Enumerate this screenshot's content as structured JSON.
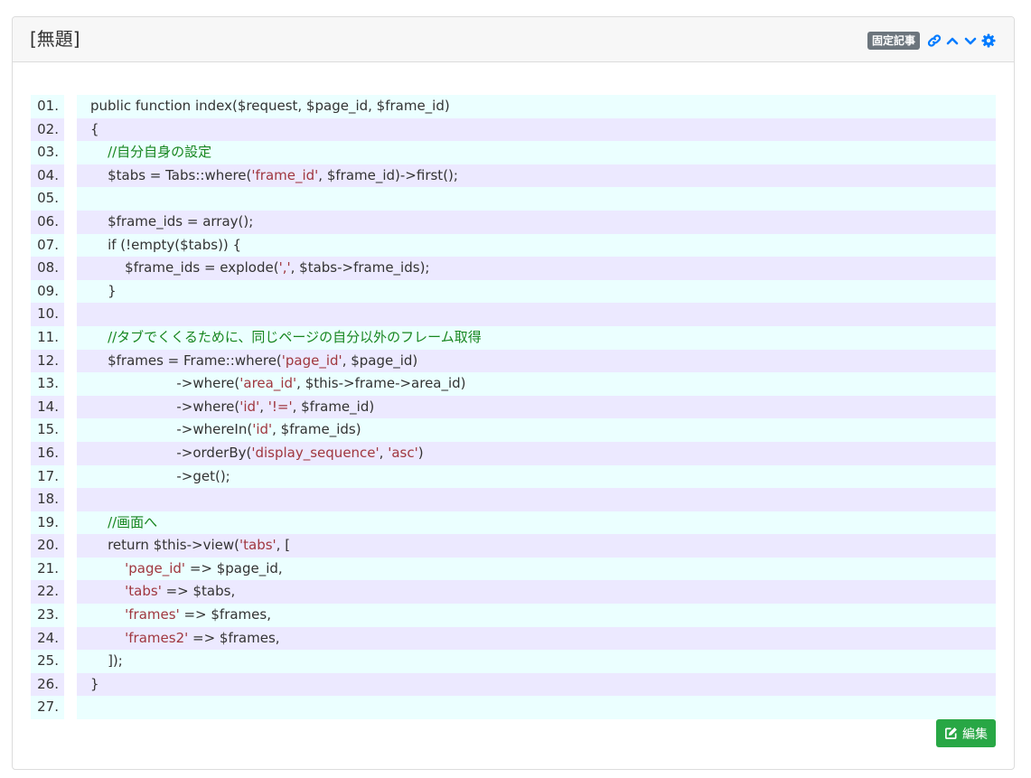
{
  "header": {
    "title": "[無題]",
    "pinned_badge": "固定記事",
    "icons": [
      "link-icon",
      "chevron-up-icon",
      "chevron-down-icon",
      "gear-icon"
    ],
    "accent_color": "#007bff"
  },
  "code": {
    "lines": [
      {
        "num": "01.",
        "parts": [
          [
            "t",
            "public function index($request, $page_id, $frame_id)"
          ]
        ]
      },
      {
        "num": "02.",
        "parts": [
          [
            "t",
            "{"
          ]
        ]
      },
      {
        "num": "03.",
        "parts": [
          [
            "t",
            "    "
          ],
          [
            "c",
            "//自分自身の設定"
          ]
        ]
      },
      {
        "num": "04.",
        "parts": [
          [
            "t",
            "    $tabs = Tabs::where("
          ],
          [
            "s",
            "'frame_id'"
          ],
          [
            "t",
            ", $frame_id)->first();"
          ]
        ]
      },
      {
        "num": "05.",
        "parts": [
          [
            "t",
            ""
          ]
        ]
      },
      {
        "num": "06.",
        "parts": [
          [
            "t",
            "    $frame_ids = array();"
          ]
        ]
      },
      {
        "num": "07.",
        "parts": [
          [
            "t",
            "    if (!empty($tabs)) {"
          ]
        ]
      },
      {
        "num": "08.",
        "parts": [
          [
            "t",
            "        $frame_ids = explode("
          ],
          [
            "s",
            "','"
          ],
          [
            "t",
            ", $tabs->frame_ids);"
          ]
        ]
      },
      {
        "num": "09.",
        "parts": [
          [
            "t",
            "    }"
          ]
        ]
      },
      {
        "num": "10.",
        "parts": [
          [
            "t",
            ""
          ]
        ]
      },
      {
        "num": "11.",
        "parts": [
          [
            "t",
            "    "
          ],
          [
            "c",
            "//タブでくくるために、同じページの自分以外のフレーム取得"
          ]
        ]
      },
      {
        "num": "12.",
        "parts": [
          [
            "t",
            "    $frames = Frame::where("
          ],
          [
            "s",
            "'page_id'"
          ],
          [
            "t",
            ", $page_id)"
          ]
        ]
      },
      {
        "num": "13.",
        "parts": [
          [
            "t",
            "                    ->where("
          ],
          [
            "s",
            "'area_id'"
          ],
          [
            "t",
            ", $this->frame->area_id)"
          ]
        ]
      },
      {
        "num": "14.",
        "parts": [
          [
            "t",
            "                    ->where("
          ],
          [
            "s",
            "'id'"
          ],
          [
            "t",
            ", "
          ],
          [
            "s",
            "'!='"
          ],
          [
            "t",
            ", $frame_id)"
          ]
        ]
      },
      {
        "num": "15.",
        "parts": [
          [
            "t",
            "                    ->whereIn("
          ],
          [
            "s",
            "'id'"
          ],
          [
            "t",
            ", $frame_ids)"
          ]
        ]
      },
      {
        "num": "16.",
        "parts": [
          [
            "t",
            "                    ->orderBy("
          ],
          [
            "s",
            "'display_sequence'"
          ],
          [
            "t",
            ", "
          ],
          [
            "s",
            "'asc'"
          ],
          [
            "t",
            ")"
          ]
        ]
      },
      {
        "num": "17.",
        "parts": [
          [
            "t",
            "                    ->get();"
          ]
        ]
      },
      {
        "num": "18.",
        "parts": [
          [
            "t",
            ""
          ]
        ]
      },
      {
        "num": "19.",
        "parts": [
          [
            "t",
            "    "
          ],
          [
            "c",
            "//画面へ"
          ]
        ]
      },
      {
        "num": "20.",
        "parts": [
          [
            "t",
            "    return $this->view("
          ],
          [
            "s",
            "'tabs'"
          ],
          [
            "t",
            ", ["
          ]
        ]
      },
      {
        "num": "21.",
        "parts": [
          [
            "t",
            "        "
          ],
          [
            "s",
            "'page_id'"
          ],
          [
            "t",
            " => $page_id,"
          ]
        ]
      },
      {
        "num": "22.",
        "parts": [
          [
            "t",
            "        "
          ],
          [
            "s",
            "'tabs'"
          ],
          [
            "t",
            " => $tabs,"
          ]
        ]
      },
      {
        "num": "23.",
        "parts": [
          [
            "t",
            "        "
          ],
          [
            "s",
            "'frames'"
          ],
          [
            "t",
            " => $frames,"
          ]
        ]
      },
      {
        "num": "24.",
        "parts": [
          [
            "t",
            "        "
          ],
          [
            "s",
            "'frames2'"
          ],
          [
            "t",
            " => $frames,"
          ]
        ]
      },
      {
        "num": "25.",
        "parts": [
          [
            "t",
            "    ]);"
          ]
        ]
      },
      {
        "num": "26.",
        "parts": [
          [
            "t",
            "}"
          ]
        ]
      },
      {
        "num": "27.",
        "parts": [
          [
            "t",
            ""
          ]
        ]
      }
    ]
  },
  "footer": {
    "edit_label": "編集",
    "edit_color": "#28a745"
  }
}
